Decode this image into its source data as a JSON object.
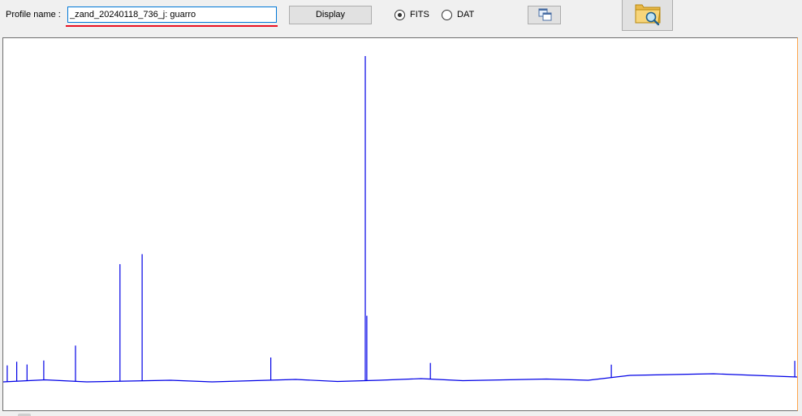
{
  "profile": {
    "label": "Profile name :",
    "value": "_zand_20240118_736_j: guarro"
  },
  "buttons": {
    "display_label": "Display"
  },
  "format": {
    "options": [
      "FITS",
      "DAT"
    ],
    "selected": "FITS"
  },
  "icons": {
    "copy": "copy-windows-icon",
    "browse": "folder-magnifier-icon"
  },
  "colors": {
    "spectrum_line": "#0000e6",
    "input_underline": "#e81123",
    "plot_background": "#ffffff"
  },
  "chart_data": {
    "type": "line",
    "title": "",
    "xlabel": "",
    "ylabel": "",
    "axes_visible": false,
    "grid": false,
    "continuum_trend": "flat, small hump then step down near 62% of the x-range",
    "series": [
      {
        "values": [
          3,
          3.5,
          3,
          3.2,
          3.4,
          3,
          3.3,
          3.6,
          3.1,
          3.4,
          3.8,
          3.3,
          3.5,
          3.7,
          3.4,
          4.6,
          4.8,
          5,
          4.6,
          4.2
        ]
      }
    ],
    "emission_lines": [
      {
        "x_fraction": 0.005,
        "relative_height": 0.05
      },
      {
        "x_fraction": 0.017,
        "relative_height": 0.06
      },
      {
        "x_fraction": 0.03,
        "relative_height": 0.05
      },
      {
        "x_fraction": 0.051,
        "relative_height": 0.06
      },
      {
        "x_fraction": 0.091,
        "relative_height": 0.11
      },
      {
        "x_fraction": 0.147,
        "relative_height": 0.36
      },
      {
        "x_fraction": 0.175,
        "relative_height": 0.39
      },
      {
        "x_fraction": 0.337,
        "relative_height": 0.07
      },
      {
        "x_fraction": 0.456,
        "relative_height": 1.0
      },
      {
        "x_fraction": 0.458,
        "relative_height": 0.2
      },
      {
        "x_fraction": 0.538,
        "relative_height": 0.05
      },
      {
        "x_fraction": 0.766,
        "relative_height": 0.04
      },
      {
        "x_fraction": 0.997,
        "relative_height": 0.05
      }
    ]
  }
}
